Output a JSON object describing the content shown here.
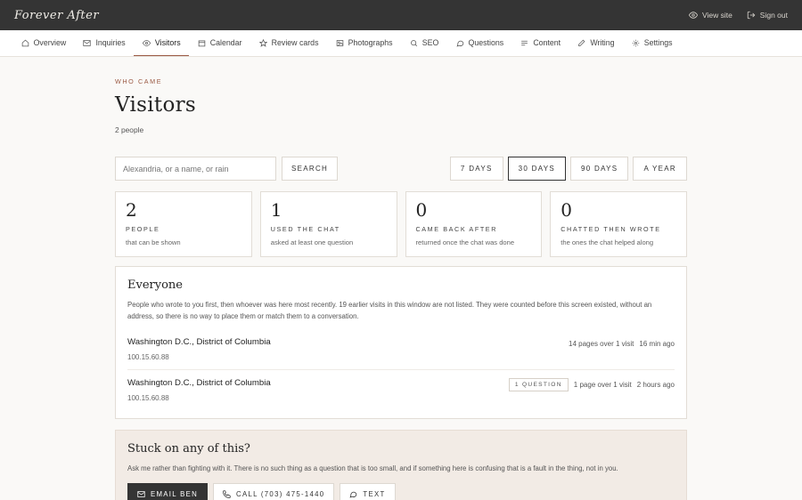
{
  "header": {
    "brand": "Forever After",
    "view_site": "View site",
    "sign_out": "Sign out"
  },
  "nav": [
    {
      "label": "Overview",
      "icon": "home-icon"
    },
    {
      "label": "Inquiries",
      "icon": "mail-icon"
    },
    {
      "label": "Visitors",
      "icon": "eye-icon",
      "active": true
    },
    {
      "label": "Calendar",
      "icon": "calendar-icon"
    },
    {
      "label": "Review cards",
      "icon": "star-icon"
    },
    {
      "label": "Photographs",
      "icon": "image-icon"
    },
    {
      "label": "SEO",
      "icon": "search-icon"
    },
    {
      "label": "Questions",
      "icon": "chat-icon"
    },
    {
      "label": "Content",
      "icon": "lines-icon"
    },
    {
      "label": "Writing",
      "icon": "pencil-icon"
    },
    {
      "label": "Settings",
      "icon": "gear-icon"
    }
  ],
  "page": {
    "eyebrow": "WHO CAME",
    "title": "Visitors",
    "subtitle": "2 people"
  },
  "search": {
    "placeholder": "Alexandria, or a name, or rain",
    "button": "SEARCH"
  },
  "ranges": [
    {
      "label": "7 DAYS",
      "active": false
    },
    {
      "label": "30 DAYS",
      "active": true
    },
    {
      "label": "90 DAYS",
      "active": false
    },
    {
      "label": "A YEAR",
      "active": false
    }
  ],
  "stats": [
    {
      "value": "2",
      "label": "PEOPLE",
      "desc": "that can be shown"
    },
    {
      "value": "1",
      "label": "USED THE CHAT",
      "desc": "asked at least one question"
    },
    {
      "value": "0",
      "label": "CAME BACK AFTER",
      "desc": "returned once the chat was done"
    },
    {
      "value": "0",
      "label": "CHATTED THEN WROTE",
      "desc": "the ones the chat helped along"
    }
  ],
  "everyone": {
    "title": "Everyone",
    "desc": "People who wrote to you first, then whoever was here most recently. 19 earlier visits in this window are not listed. They were counted before this screen existed, without an address, so there is no way to place them or match them to a conversation.",
    "visits": [
      {
        "location": "Washington D.C., District of Columbia",
        "ip": "100.15.60.88",
        "badge": "",
        "pages": "14 pages over 1 visit",
        "when": "16 min ago"
      },
      {
        "location": "Washington D.C., District of Columbia",
        "ip": "100.15.60.88",
        "badge": "1 QUESTION",
        "pages": "1 page over 1 visit",
        "when": "2 hours ago"
      }
    ]
  },
  "help": {
    "title": "Stuck on any of this?",
    "desc": "Ask me rather than fighting with it. There is no such thing as a question that is too small, and if something here is confusing that is a fault in the thing, not in you.",
    "email": "EMAIL BEN",
    "call": "CALL (703) 475-1440",
    "text": "TEXT"
  },
  "colors": {
    "topbar": "#343434",
    "accent": "#9b5a44",
    "help_bg": "#f2ebe5"
  }
}
